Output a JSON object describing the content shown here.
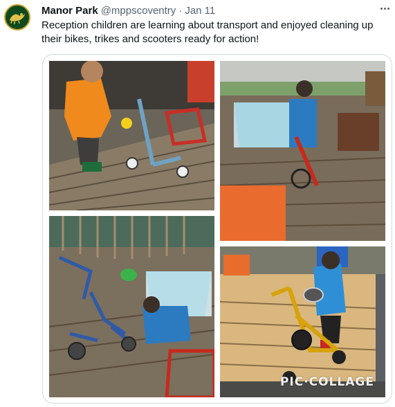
{
  "tweet": {
    "author_name": "Manor Park",
    "author_handle": "@mppscoventry",
    "separator": "·",
    "date": "Jan 11",
    "text": "Reception children are learning about transport and enjoyed cleaning up their bikes, trikes and scooters ready for action!",
    "avatar_icon": "school-crest-icon",
    "more_icon": "more-options-icon"
  },
  "media": {
    "collage_watermark": "PIC·COLLAGE",
    "photos": [
      "photo-child-scooter",
      "photo-child-water-tub",
      "photo-trikes-wash",
      "photo-child-yellow-trike"
    ]
  },
  "colors": {
    "text_primary": "#0f1419",
    "text_secondary": "#536471",
    "border": "#cfd9de",
    "avatar_green": "#0f4a1e",
    "avatar_gold": "#c9a227"
  }
}
